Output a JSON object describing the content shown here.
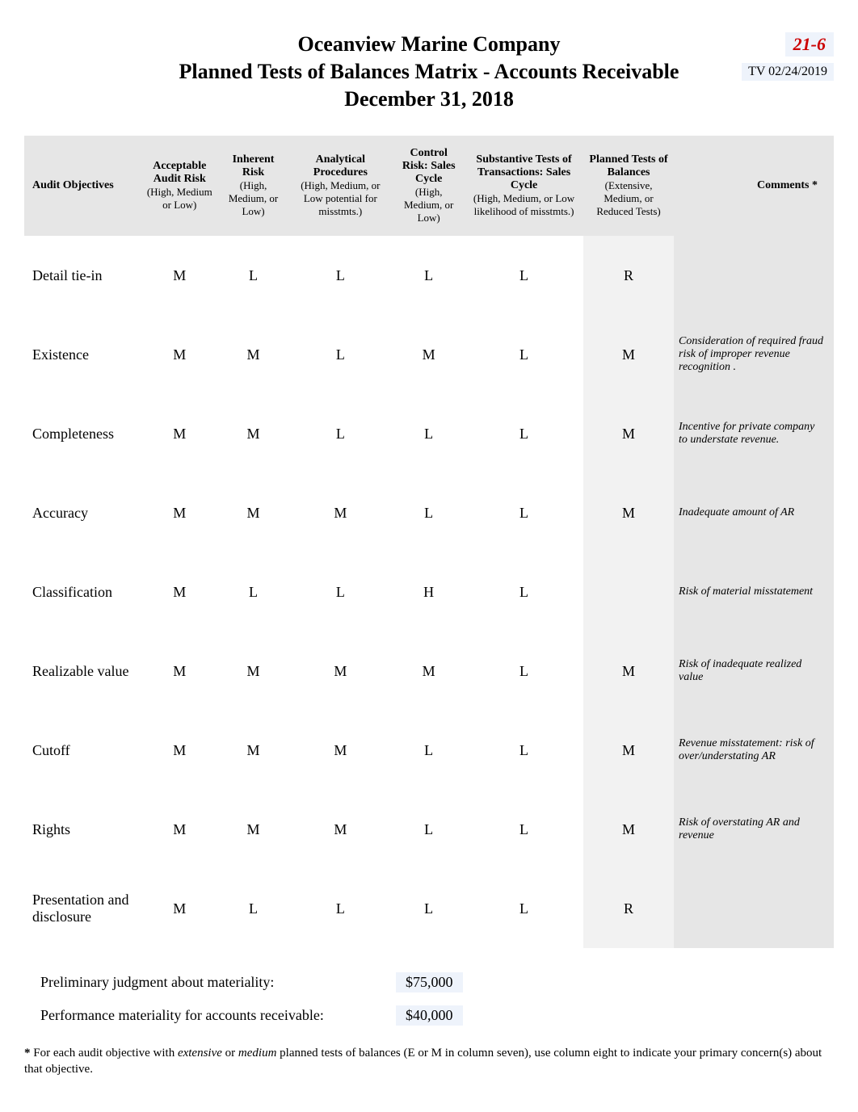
{
  "header": {
    "company": "Oceanview Marine Company",
    "subtitle": "Planned Tests of Balances Matrix - Accounts Receivable",
    "date": "December 31, 2018",
    "ref": "21-6",
    "initials_date": "TV 02/24/2019"
  },
  "columns": {
    "c1": {
      "title": "Audit Objectives",
      "sub": ""
    },
    "c2": {
      "title": "Acceptable Audit Risk",
      "sub": "(High, Medium or Low)"
    },
    "c3": {
      "title": "Inherent Risk",
      "sub": "(High, Medium, or Low)"
    },
    "c4": {
      "title": "Analytical Procedures",
      "sub": "(High, Medium, or Low potential for misstmts.)"
    },
    "c5": {
      "title": "Control Risk: Sales Cycle",
      "sub": "(High, Medium, or Low)"
    },
    "c6": {
      "title": "Substantive Tests of Transactions: Sales Cycle",
      "sub": "(High, Medium, or Low likelihood of misstmts.)"
    },
    "c7": {
      "title": "Planned Tests of Balances",
      "sub": "(Extensive, Medium, or Reduced Tests)"
    },
    "c8": {
      "title": "Comments *",
      "sub": ""
    }
  },
  "rows": [
    {
      "objective": "Detail tie-in",
      "aar": "M",
      "ir": "L",
      "ap": "L",
      "cr": "L",
      "stt": "L",
      "ptb": "R",
      "comment": ""
    },
    {
      "objective": "Existence",
      "aar": "M",
      "ir": "M",
      "ap": "L",
      "cr": "M",
      "stt": "L",
      "ptb": "M",
      "comment": "Consideration of required fraud risk of improper revenue recognition ."
    },
    {
      "objective": "Completeness",
      "aar": "M",
      "ir": "M",
      "ap": "L",
      "cr": "L",
      "stt": "L",
      "ptb": "M",
      "comment": "Incentive for private company to understate revenue."
    },
    {
      "objective": "Accuracy",
      "aar": "M",
      "ir": "M",
      "ap": "M",
      "cr": "L",
      "stt": "L",
      "ptb": "M",
      "comment": "Inadequate amount of AR"
    },
    {
      "objective": "Classification",
      "aar": "M",
      "ir": "L",
      "ap": "L",
      "cr": "H",
      "stt": "L",
      "ptb": "",
      "comment": "Risk of material misstatement"
    },
    {
      "objective": "Realizable value",
      "aar": "M",
      "ir": "M",
      "ap": "M",
      "cr": "M",
      "stt": "L",
      "ptb": "M",
      "comment": "Risk of inadequate realized value"
    },
    {
      "objective": "Cutoff",
      "aar": "M",
      "ir": "M",
      "ap": "M",
      "cr": "L",
      "stt": "L",
      "ptb": "M",
      "comment": "Revenue misstatement: risk of over/understating AR"
    },
    {
      "objective": "Rights",
      "aar": "M",
      "ir": "M",
      "ap": "M",
      "cr": "L",
      "stt": "L",
      "ptb": "M",
      "comment": "Risk of overstating AR and revenue"
    },
    {
      "objective": "Presentation and disclosure",
      "aar": "M",
      "ir": "L",
      "ap": "L",
      "cr": "L",
      "stt": "L",
      "ptb": "R",
      "comment": ""
    }
  ],
  "summary": {
    "prelim_label": "Preliminary judgment about materiality:",
    "prelim_value": "$75,000",
    "perf_label": "Performance materiality for accounts receivable:",
    "perf_value": "$40,000"
  },
  "footnote": {
    "star": "*",
    "text1": " For each audit objective with ",
    "em1": "extensive",
    "text2": " or ",
    "em2": "medium",
    "text3": " planned tests of balances (E or M in column seven), use column eight to indicate your primary concern(s) about that objective."
  }
}
